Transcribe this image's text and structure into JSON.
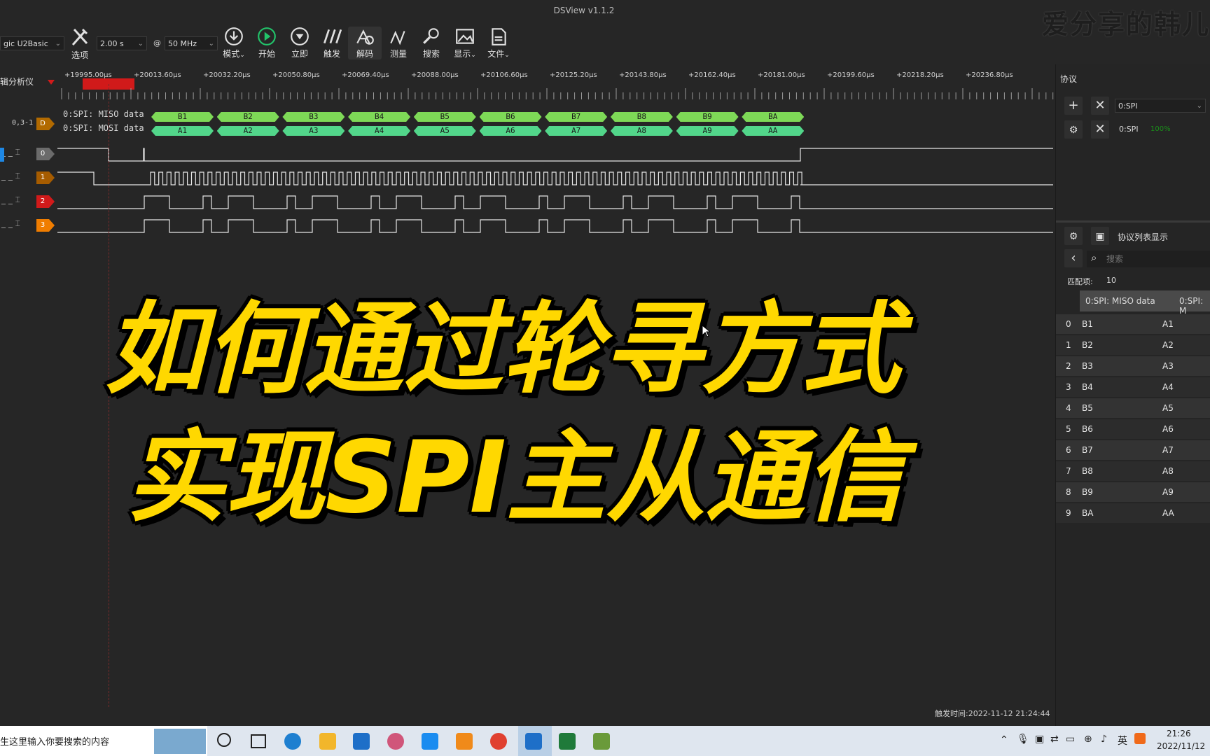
{
  "window": {
    "title": "DSView v1.1.2",
    "watermark": "爱分享的韩儿"
  },
  "toolbar": {
    "device": "gic U2Basic",
    "options_label": "选项",
    "duration": "2.00 s",
    "at": "@",
    "samplerate": "50 MHz",
    "tools": [
      {
        "label": "模式",
        "icon": "download-icon",
        "dropdown": true
      },
      {
        "label": "开始",
        "icon": "play-icon",
        "dropdown": false
      },
      {
        "label": "立即",
        "icon": "capture-icon",
        "dropdown": false
      },
      {
        "label": "触发",
        "icon": "trigger-icon",
        "dropdown": false
      },
      {
        "label": "解码",
        "icon": "decode-icon",
        "dropdown": false
      },
      {
        "label": "测量",
        "icon": "measure-icon",
        "dropdown": false
      },
      {
        "label": "搜索",
        "icon": "search-icon",
        "dropdown": false
      },
      {
        "label": "显示",
        "icon": "display-icon",
        "dropdown": true
      },
      {
        "label": "文件",
        "icon": "file-icon",
        "dropdown": true
      }
    ]
  },
  "left_header": {
    "title": "辑分析仪"
  },
  "ruler": {
    "ticks": [
      "+19995.00μs",
      "+20013.60μs",
      "+20032.20μs",
      "+20050.80μs",
      "+20069.40μs",
      "+20088.00μs",
      "+20106.60μs",
      "+20125.20μs",
      "+20143.80μs",
      "+20162.40μs",
      "+20181.00μs",
      "+20199.60μs",
      "+20218.20μs",
      "+20236.80μs"
    ]
  },
  "decode": {
    "group_label": "0,3-1",
    "tag": "D",
    "miso_label": "0:SPI: MISO data",
    "mosi_label": "0:SPI: MOSI data",
    "miso": [
      "B1",
      "B2",
      "B3",
      "B4",
      "B5",
      "B6",
      "B7",
      "B8",
      "B9",
      "BA"
    ],
    "mosi": [
      "A1",
      "A2",
      "A3",
      "A4",
      "A5",
      "A6",
      "A7",
      "A8",
      "A9",
      "AA"
    ]
  },
  "channels": [
    {
      "id": "0",
      "color": "#6b6b6b"
    },
    {
      "id": "1",
      "color": "#a65c00"
    },
    {
      "id": "2",
      "color": "#d11a1a"
    },
    {
      "id": "3",
      "color": "#f07d00"
    }
  ],
  "headline": {
    "line1": "如何通过轮寻方式",
    "line2": "实现SPI主从通信"
  },
  "trigger_time": "触发时间:2022-11-12 21:24:44",
  "right_panel": {
    "title": "协议",
    "protocol_select": "0:SPI",
    "protocol_item": "0:SPI",
    "progress": "100%",
    "list_title": "协议列表显示",
    "search_placeholder": "搜索",
    "match_label": "匹配项:",
    "match_count": "10",
    "col1": "0:SPI: MISO data",
    "col2": "0:SPI: M",
    "rows": [
      {
        "i": "0",
        "a": "B1",
        "b": "A1"
      },
      {
        "i": "1",
        "a": "B2",
        "b": "A2"
      },
      {
        "i": "2",
        "a": "B3",
        "b": "A3"
      },
      {
        "i": "3",
        "a": "B4",
        "b": "A4"
      },
      {
        "i": "4",
        "a": "B5",
        "b": "A5"
      },
      {
        "i": "5",
        "a": "B6",
        "b": "A6"
      },
      {
        "i": "6",
        "a": "B7",
        "b": "A7"
      },
      {
        "i": "7",
        "a": "B8",
        "b": "A8"
      },
      {
        "i": "8",
        "a": "B9",
        "b": "A9"
      },
      {
        "i": "9",
        "a": "BA",
        "b": "AA"
      }
    ]
  },
  "taskbar": {
    "search_text": "生这里输入你要搜索的内容",
    "time": "21:26",
    "date": "2022/11/12"
  }
}
